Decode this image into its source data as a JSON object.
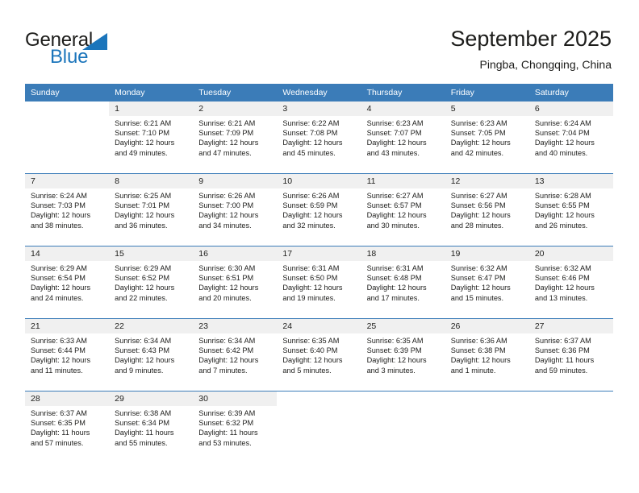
{
  "logo": {
    "word_top": "General",
    "word_bottom": "Blue",
    "accent_color": "#1b75bb",
    "triangle_icon": "triangle-icon"
  },
  "header": {
    "title": "September 2025",
    "subtitle": "Pingba, Chongqing, China"
  },
  "theme": {
    "header_blue": "#3b7cb8",
    "daynum_gray": "#f0f0f0",
    "text": "#1d1d1b"
  },
  "weekday_headers": [
    "Sunday",
    "Monday",
    "Tuesday",
    "Wednesday",
    "Thursday",
    "Friday",
    "Saturday"
  ],
  "weeks": [
    [
      {
        "day": "",
        "empty": true
      },
      {
        "day": "1",
        "sunrise": "Sunrise: 6:21 AM",
        "sunset": "Sunset: 7:10 PM",
        "daylight_line1": "Daylight: 12 hours",
        "daylight_line2": "and 49 minutes."
      },
      {
        "day": "2",
        "sunrise": "Sunrise: 6:21 AM",
        "sunset": "Sunset: 7:09 PM",
        "daylight_line1": "Daylight: 12 hours",
        "daylight_line2": "and 47 minutes."
      },
      {
        "day": "3",
        "sunrise": "Sunrise: 6:22 AM",
        "sunset": "Sunset: 7:08 PM",
        "daylight_line1": "Daylight: 12 hours",
        "daylight_line2": "and 45 minutes."
      },
      {
        "day": "4",
        "sunrise": "Sunrise: 6:23 AM",
        "sunset": "Sunset: 7:07 PM",
        "daylight_line1": "Daylight: 12 hours",
        "daylight_line2": "and 43 minutes."
      },
      {
        "day": "5",
        "sunrise": "Sunrise: 6:23 AM",
        "sunset": "Sunset: 7:05 PM",
        "daylight_line1": "Daylight: 12 hours",
        "daylight_line2": "and 42 minutes."
      },
      {
        "day": "6",
        "sunrise": "Sunrise: 6:24 AM",
        "sunset": "Sunset: 7:04 PM",
        "daylight_line1": "Daylight: 12 hours",
        "daylight_line2": "and 40 minutes."
      }
    ],
    [
      {
        "day": "7",
        "sunrise": "Sunrise: 6:24 AM",
        "sunset": "Sunset: 7:03 PM",
        "daylight_line1": "Daylight: 12 hours",
        "daylight_line2": "and 38 minutes."
      },
      {
        "day": "8",
        "sunrise": "Sunrise: 6:25 AM",
        "sunset": "Sunset: 7:01 PM",
        "daylight_line1": "Daylight: 12 hours",
        "daylight_line2": "and 36 minutes."
      },
      {
        "day": "9",
        "sunrise": "Sunrise: 6:26 AM",
        "sunset": "Sunset: 7:00 PM",
        "daylight_line1": "Daylight: 12 hours",
        "daylight_line2": "and 34 minutes."
      },
      {
        "day": "10",
        "sunrise": "Sunrise: 6:26 AM",
        "sunset": "Sunset: 6:59 PM",
        "daylight_line1": "Daylight: 12 hours",
        "daylight_line2": "and 32 minutes."
      },
      {
        "day": "11",
        "sunrise": "Sunrise: 6:27 AM",
        "sunset": "Sunset: 6:57 PM",
        "daylight_line1": "Daylight: 12 hours",
        "daylight_line2": "and 30 minutes."
      },
      {
        "day": "12",
        "sunrise": "Sunrise: 6:27 AM",
        "sunset": "Sunset: 6:56 PM",
        "daylight_line1": "Daylight: 12 hours",
        "daylight_line2": "and 28 minutes."
      },
      {
        "day": "13",
        "sunrise": "Sunrise: 6:28 AM",
        "sunset": "Sunset: 6:55 PM",
        "daylight_line1": "Daylight: 12 hours",
        "daylight_line2": "and 26 minutes."
      }
    ],
    [
      {
        "day": "14",
        "sunrise": "Sunrise: 6:29 AM",
        "sunset": "Sunset: 6:54 PM",
        "daylight_line1": "Daylight: 12 hours",
        "daylight_line2": "and 24 minutes."
      },
      {
        "day": "15",
        "sunrise": "Sunrise: 6:29 AM",
        "sunset": "Sunset: 6:52 PM",
        "daylight_line1": "Daylight: 12 hours",
        "daylight_line2": "and 22 minutes."
      },
      {
        "day": "16",
        "sunrise": "Sunrise: 6:30 AM",
        "sunset": "Sunset: 6:51 PM",
        "daylight_line1": "Daylight: 12 hours",
        "daylight_line2": "and 20 minutes."
      },
      {
        "day": "17",
        "sunrise": "Sunrise: 6:31 AM",
        "sunset": "Sunset: 6:50 PM",
        "daylight_line1": "Daylight: 12 hours",
        "daylight_line2": "and 19 minutes."
      },
      {
        "day": "18",
        "sunrise": "Sunrise: 6:31 AM",
        "sunset": "Sunset: 6:48 PM",
        "daylight_line1": "Daylight: 12 hours",
        "daylight_line2": "and 17 minutes."
      },
      {
        "day": "19",
        "sunrise": "Sunrise: 6:32 AM",
        "sunset": "Sunset: 6:47 PM",
        "daylight_line1": "Daylight: 12 hours",
        "daylight_line2": "and 15 minutes."
      },
      {
        "day": "20",
        "sunrise": "Sunrise: 6:32 AM",
        "sunset": "Sunset: 6:46 PM",
        "daylight_line1": "Daylight: 12 hours",
        "daylight_line2": "and 13 minutes."
      }
    ],
    [
      {
        "day": "21",
        "sunrise": "Sunrise: 6:33 AM",
        "sunset": "Sunset: 6:44 PM",
        "daylight_line1": "Daylight: 12 hours",
        "daylight_line2": "and 11 minutes."
      },
      {
        "day": "22",
        "sunrise": "Sunrise: 6:34 AM",
        "sunset": "Sunset: 6:43 PM",
        "daylight_line1": "Daylight: 12 hours",
        "daylight_line2": "and 9 minutes."
      },
      {
        "day": "23",
        "sunrise": "Sunrise: 6:34 AM",
        "sunset": "Sunset: 6:42 PM",
        "daylight_line1": "Daylight: 12 hours",
        "daylight_line2": "and 7 minutes."
      },
      {
        "day": "24",
        "sunrise": "Sunrise: 6:35 AM",
        "sunset": "Sunset: 6:40 PM",
        "daylight_line1": "Daylight: 12 hours",
        "daylight_line2": "and 5 minutes."
      },
      {
        "day": "25",
        "sunrise": "Sunrise: 6:35 AM",
        "sunset": "Sunset: 6:39 PM",
        "daylight_line1": "Daylight: 12 hours",
        "daylight_line2": "and 3 minutes."
      },
      {
        "day": "26",
        "sunrise": "Sunrise: 6:36 AM",
        "sunset": "Sunset: 6:38 PM",
        "daylight_line1": "Daylight: 12 hours",
        "daylight_line2": "and 1 minute."
      },
      {
        "day": "27",
        "sunrise": "Sunrise: 6:37 AM",
        "sunset": "Sunset: 6:36 PM",
        "daylight_line1": "Daylight: 11 hours",
        "daylight_line2": "and 59 minutes."
      }
    ],
    [
      {
        "day": "28",
        "sunrise": "Sunrise: 6:37 AM",
        "sunset": "Sunset: 6:35 PM",
        "daylight_line1": "Daylight: 11 hours",
        "daylight_line2": "and 57 minutes."
      },
      {
        "day": "29",
        "sunrise": "Sunrise: 6:38 AM",
        "sunset": "Sunset: 6:34 PM",
        "daylight_line1": "Daylight: 11 hours",
        "daylight_line2": "and 55 minutes."
      },
      {
        "day": "30",
        "sunrise": "Sunrise: 6:39 AM",
        "sunset": "Sunset: 6:32 PM",
        "daylight_line1": "Daylight: 11 hours",
        "daylight_line2": "and 53 minutes."
      },
      {
        "day": "",
        "empty": true
      },
      {
        "day": "",
        "empty": true
      },
      {
        "day": "",
        "empty": true
      },
      {
        "day": "",
        "empty": true
      }
    ]
  ]
}
